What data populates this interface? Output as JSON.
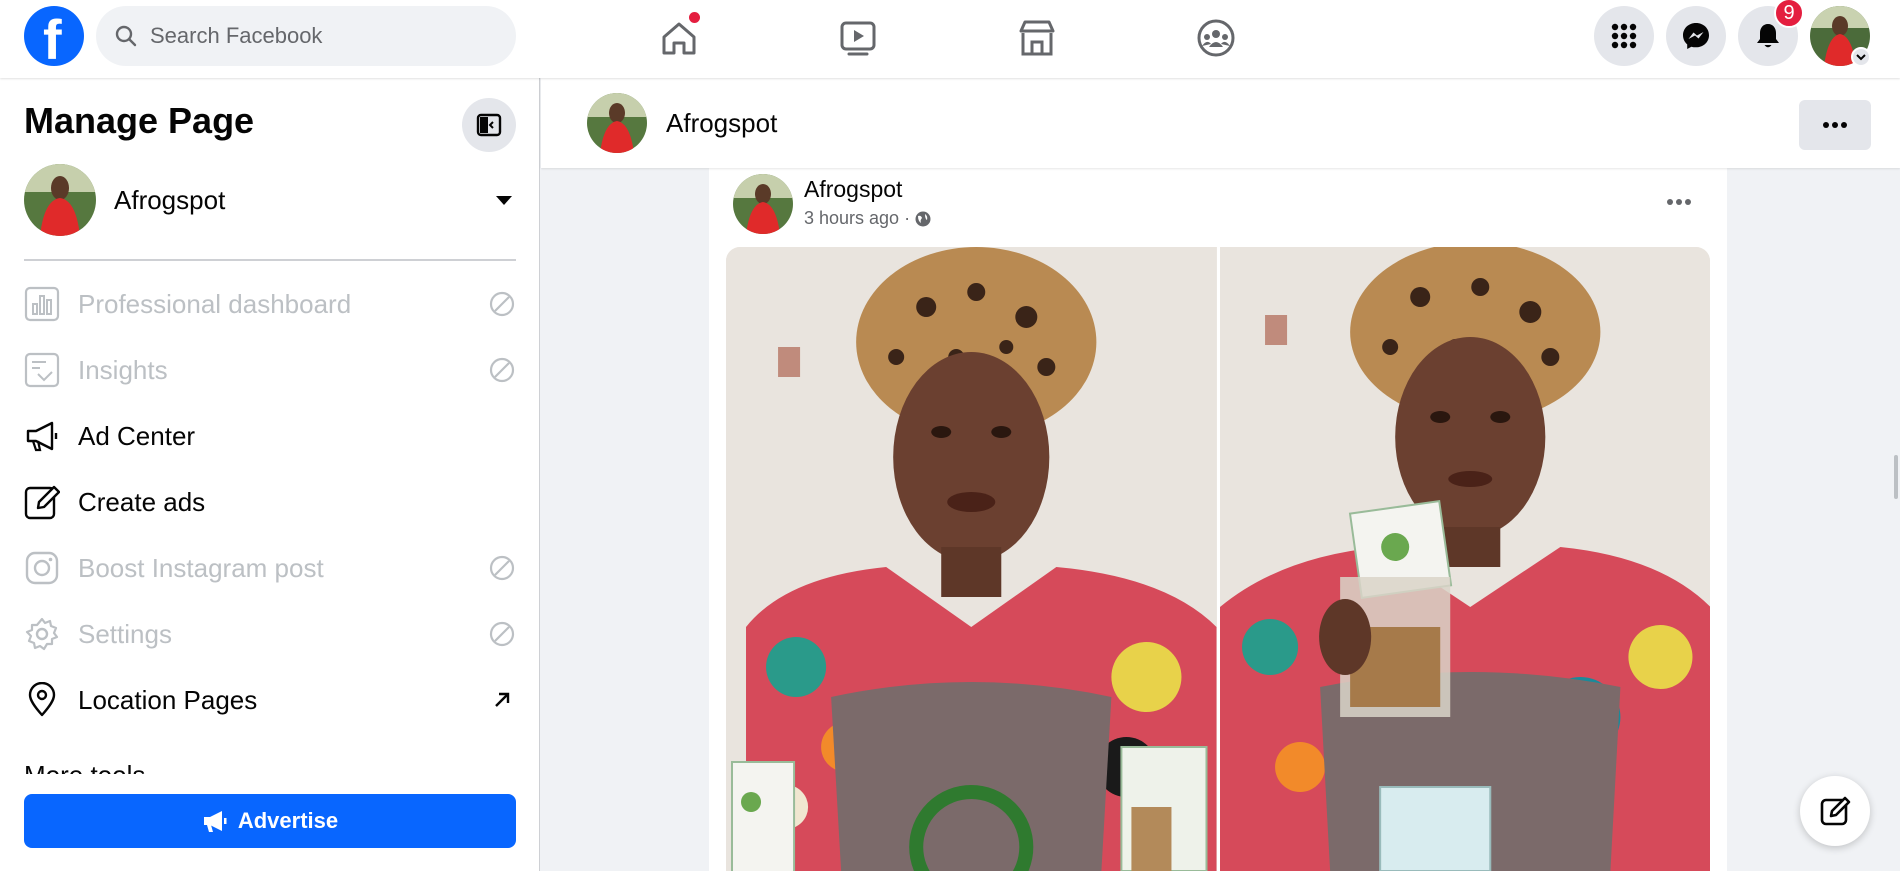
{
  "topbar": {
    "search_placeholder": "Search Facebook",
    "notification_count": "9",
    "nav_icons": [
      "home-icon",
      "video-icon",
      "marketplace-icon",
      "groups-icon"
    ],
    "right_icons": [
      "menu-grid-icon",
      "messenger-icon",
      "bell-icon"
    ]
  },
  "sidebar": {
    "title": "Manage Page",
    "page_name": "Afrogspot",
    "items": [
      {
        "label": "Professional dashboard",
        "icon": "dashboard-icon",
        "state": "disabled"
      },
      {
        "label": "Insights",
        "icon": "insights-icon",
        "state": "disabled"
      },
      {
        "label": "Ad Center",
        "icon": "megaphone-icon",
        "state": "enabled"
      },
      {
        "label": "Create ads",
        "icon": "pencil-square-icon",
        "state": "enabled"
      },
      {
        "label": "Boost Instagram post",
        "icon": "instagram-icon",
        "state": "disabled"
      },
      {
        "label": "Settings",
        "icon": "gear-icon",
        "state": "disabled"
      },
      {
        "label": "Location Pages",
        "icon": "location-pin-icon",
        "state": "external"
      }
    ],
    "more_tools_label": "More tools",
    "advertise_label": "Advertise"
  },
  "page_header": {
    "name": "Afrogspot"
  },
  "post": {
    "author": "Afrogspot",
    "time": "3 hours ago",
    "separator": "·",
    "privacy_icon": "globe-icon",
    "photo_count": 2
  },
  "colors": {
    "brand_blue": "#0866ff",
    "badge_red": "#e41e3f",
    "disabled_text": "#bcc0c4",
    "page_bg": "#f0f2f5"
  }
}
